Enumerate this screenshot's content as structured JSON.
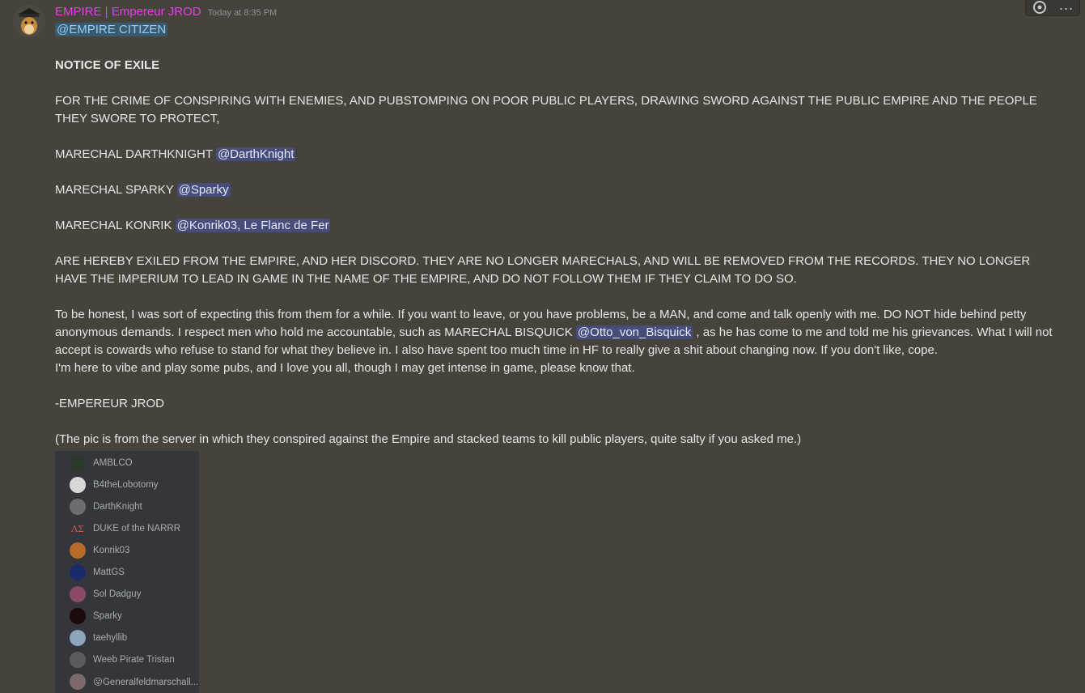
{
  "message": {
    "author": "EMPIRE | Empereur JROD",
    "timestamp": "Today at 8:35 PM",
    "role_mention": "@EMPIRE CITIZEN",
    "title": "NOTICE OF EXILE",
    "crime": "FOR THE CRIME OF CONSPIRING WITH ENEMIES, AND PUBSTOMPING ON POOR PUBLIC PLAYERS, DRAWING SWORD AGAINST THE PUBLIC EMPIRE AND THE PEOPLE THEY SWORE TO PROTECT,",
    "exiles": [
      {
        "text": "MARECHAL DARTHKNIGHT",
        "mention": "@DarthKnight"
      },
      {
        "text": "MARECHAL SPARKY",
        "mention": "@Sparky"
      },
      {
        "text": "MARECHAL KONRIK",
        "mention": "@Konrik03, Le Flanc de Fer"
      }
    ],
    "verdict": "ARE HEREBY EXILED FROM THE EMPIRE, AND HER DISCORD. THEY ARE NO LONGER MARECHALS, AND WILL BE REMOVED FROM THE RECORDS. THEY NO LONGER HAVE THE IMPERIUM TO LEAD IN GAME IN THE NAME OF THE EMPIRE, AND DO NOT FOLLOW THEM IF THEY CLAIM TO DO SO.",
    "honest_part1": "To be honest, I was sort of expecting this from them for a while. If you want to leave, or you have problems, be a MAN, and come and talk openly with me. DO NOT hide behind petty anonymous demands. I respect men who hold me accountable, such as MARECHAL BISQUICK",
    "honest_mention": "@Otto_von_Bisquick",
    "honest_part2": ", as he has come to me and told me his grievances. What I will not accept is cowards who refuse to stand for what they believe in. I also have spent too much time in HF to really give a shit about changing now. If you don't like, cope.",
    "vibe": "I'm here to vibe and play some pubs, and I love you all, though I may get intense in game, please know that.",
    "signature": "-EMPEREUR JROD",
    "pic_note": "(The pic is from the server in which they conspired against the Empire and stacked teams to kill public players, quite salty if you asked me.)"
  },
  "attachment": {
    "members": [
      {
        "name": "AMBLCO",
        "avatar_color": "#2b3a2b",
        "glyph": ""
      },
      {
        "name": "B4theLobotomy",
        "avatar_color": "#d8d8d8",
        "glyph": ""
      },
      {
        "name": "DarthKnight",
        "avatar_color": "#6d6d6d",
        "glyph": ""
      },
      {
        "name": "DUKE of the NARRR",
        "avatar_color": "transparent",
        "glyph": "ΛΣ"
      },
      {
        "name": "Konrik03",
        "avatar_color": "#b86a2a",
        "glyph": ""
      },
      {
        "name": "MattGS",
        "avatar_color": "#1a2a6a",
        "glyph": ""
      },
      {
        "name": "Sol Dadguy",
        "avatar_color": "#8a4a6a",
        "glyph": ""
      },
      {
        "name": "Sparky",
        "avatar_color": "#1a0a0a",
        "glyph": ""
      },
      {
        "name": "taehyllib",
        "avatar_color": "#8aa6b8",
        "glyph": ""
      },
      {
        "name": "Weeb Pirate Tristan",
        "avatar_color": "#5a5a5a",
        "glyph": ""
      },
      {
        "name": "😛Generalfeldmarschall...",
        "avatar_color": "#7a6a6a",
        "glyph": ""
      }
    ]
  },
  "toolbar": {
    "add_reaction_icon": "add-reaction-icon",
    "more_icon": "more-icon",
    "more_glyph": "···"
  },
  "colors": {
    "background": "#45433c",
    "username": "#e63de6",
    "mention_bg": "#474d7a",
    "role_mention_bg": "#3b5a6e",
    "attachment_bg": "#34363c"
  }
}
